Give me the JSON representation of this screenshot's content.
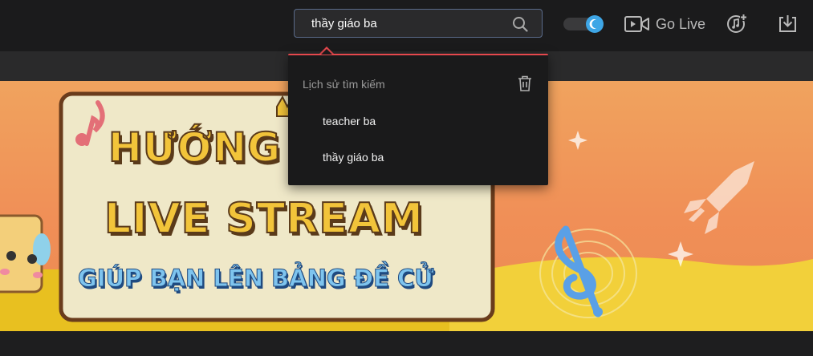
{
  "header": {
    "search": {
      "value": "thầy giáo ba",
      "icon": "search-icon"
    },
    "theme_toggle": {
      "icon": "moon-icon",
      "state": "dark"
    },
    "go_live": {
      "label": "Go Live",
      "icon": "video-camera-icon"
    },
    "music_icon": "music-add-icon",
    "download_icon": "download-icon"
  },
  "search_dropdown": {
    "heading": "Lịch sử tìm kiếm",
    "clear_icon": "trash-icon",
    "items": [
      "teacher ba",
      "thầy giáo ba"
    ]
  },
  "banner": {
    "title_line1": "HƯỚNG DẪN",
    "title_line2": "LIVE STREAM",
    "subtitle": "GIÚP BẠN LÊN BẢNG ĐỀ CỬ"
  },
  "colors": {
    "accent_red": "#e5484d",
    "toggle_blue": "#3ea6e6",
    "banner_orange": "#f0a35e",
    "banner_yellow": "#e8c020"
  }
}
